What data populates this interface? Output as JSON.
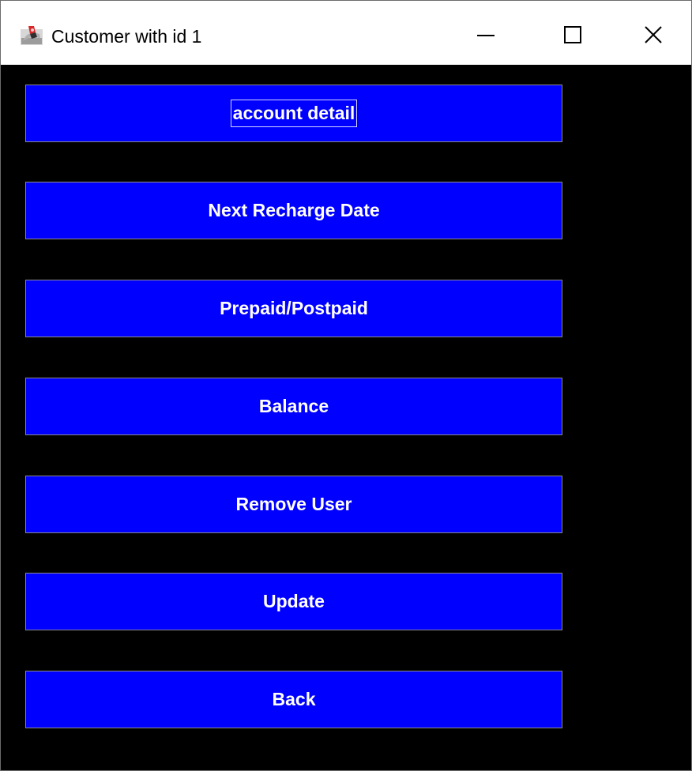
{
  "window": {
    "title": "Customer with id 1",
    "controls": {
      "minimize_icon": "minimize-icon",
      "maximize_icon": "maximize-icon",
      "close_icon": "close-icon"
    }
  },
  "buttons": [
    {
      "label": "account detail",
      "focused": true
    },
    {
      "label": "Next Recharge Date"
    },
    {
      "label": "Prepaid/Postpaid"
    },
    {
      "label": "Balance"
    },
    {
      "label": "Remove User"
    },
    {
      "label": "Update"
    },
    {
      "label": "Back"
    }
  ],
  "colors": {
    "background": "#000000",
    "button_fill": "#0000ff",
    "button_text": "#ffffff",
    "titlebar": "#ffffff"
  }
}
